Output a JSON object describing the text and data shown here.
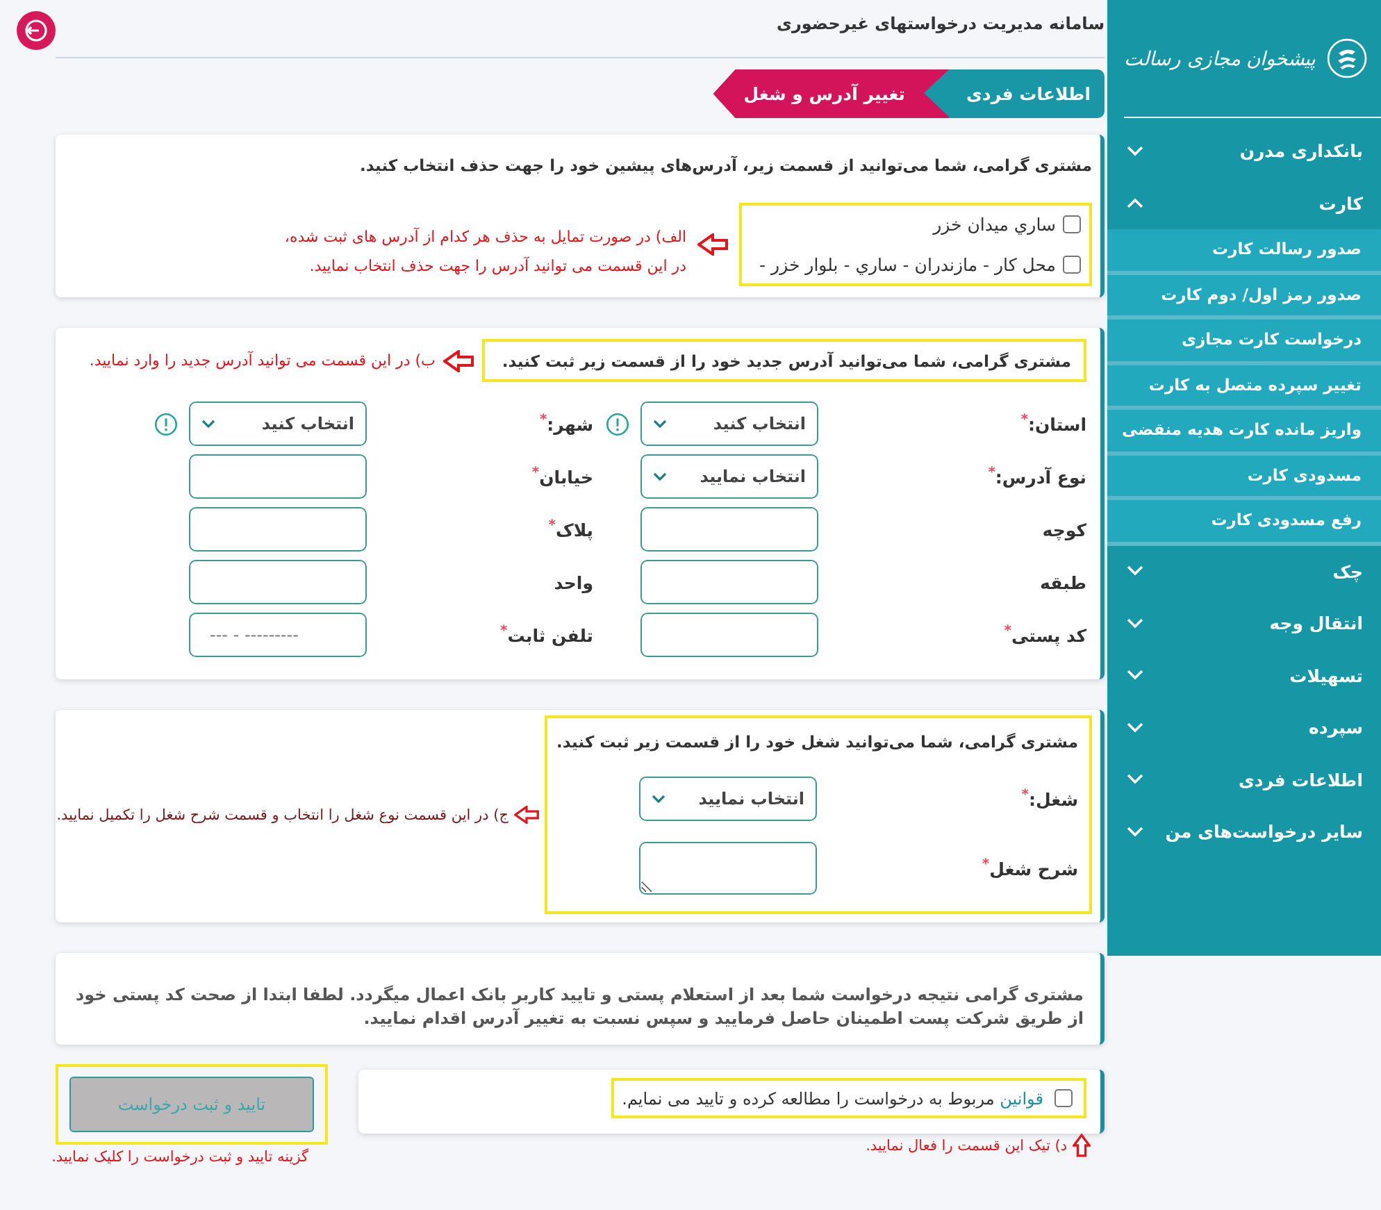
{
  "header": {
    "title": "سامانه مدیریت درخواستهای غیرحضوری"
  },
  "breadcrumb": [
    {
      "label": "اطلاعات فردی",
      "selected": false
    },
    {
      "label": "تغییر آدرس و شغل",
      "selected": true
    }
  ],
  "sidebar": {
    "brand": "پیشخوان مجازی رسالت",
    "items": [
      {
        "label": "بانکداری مدرن",
        "expanded": false
      },
      {
        "label": "کارت",
        "expanded": true,
        "children": [
          {
            "label": "صدور رسالت کارت"
          },
          {
            "label": "صدور رمز اول/ دوم کارت"
          },
          {
            "label": "درخواست کارت مجازی"
          },
          {
            "label": "تغییر سپرده متصل به کارت"
          },
          {
            "label": "واریز مانده کارت هدیه منقضی"
          },
          {
            "label": "مسدودی کارت"
          },
          {
            "label": "رفع مسدودی کارت"
          }
        ]
      },
      {
        "label": "چک",
        "expanded": false
      },
      {
        "label": "انتقال وجه",
        "expanded": false
      },
      {
        "label": "تسهیلات",
        "expanded": false
      },
      {
        "label": "سپرده",
        "expanded": false
      },
      {
        "label": "اطلاعات فردی",
        "expanded": false
      },
      {
        "label": "سایر درخواست‌های من",
        "expanded": false
      }
    ]
  },
  "addresses_section": {
    "heading": "مشتری گرامی، شما می‌توانید از قسمت زیر، آدرس‌های پیشین خود را جهت حذف انتخاب کنید.",
    "addresses": [
      {
        "label": "ساري ميدان خزر",
        "checked": false
      },
      {
        "label": "محل کار - مازندران - ساري - بلوار خزر -",
        "checked": false
      }
    ],
    "annotation": [
      "الف) در صورت تمایل به حذف هر کدام از آدرس های ثبت شده،",
      "در این قسمت می توانید آدرس را جهت حذف انتخاب نمایید."
    ]
  },
  "new_address_section": {
    "heading": "مشتری گرامی، شما می‌توانید آدرس جدید خود را از قسمت زیر ثبت کنید.",
    "annotation": "ب) در این قسمت می توانید آدرس جدید را وارد نمایید.",
    "fields": [
      {
        "label": "استان:",
        "required_mark": "*",
        "kind": "select",
        "value": "انتخاب کنید",
        "info": true
      },
      {
        "label": "شهر:",
        "required_mark": "*",
        "kind": "select",
        "value": "انتخاب کنید",
        "info": true
      },
      {
        "label": "نوع آدرس:",
        "required_mark": "*",
        "kind": "select",
        "value": "انتخاب نمایید",
        "info": false
      },
      {
        "label": "خیابان",
        "required_mark": "*",
        "kind": "text",
        "info": false
      },
      {
        "label": "کوچه",
        "kind": "text",
        "info": false
      },
      {
        "label": "پلاک",
        "required_mark": "*",
        "kind": "text",
        "info": false
      },
      {
        "label": "طبقه",
        "kind": "text",
        "info": false
      },
      {
        "label": "واحد",
        "kind": "text",
        "info": false
      },
      {
        "label": "کد پستی",
        "required_mark": "*",
        "kind": "text",
        "info": false
      },
      {
        "label": "تلفن ثابت",
        "required_mark": "*",
        "kind": "text",
        "placeholder": "--- - ---------",
        "info": false
      }
    ]
  },
  "job_section": {
    "heading": "مشتری گرامی، شما می‌توانید شغل خود را از قسمت زیر ثبت کنید.",
    "annotation": "ج) در این قسمت نوع شغل را انتخاب و قسمت شرح شغل را تکمیل نمایید.",
    "fields": [
      {
        "label": "شغل:",
        "required_mark": "*",
        "kind": "select",
        "value": "انتخاب نمایید"
      },
      {
        "label": "شرح شغل",
        "required_mark": "*",
        "kind": "textarea"
      }
    ]
  },
  "notice": "مشتری گرامی نتیجه درخواست شما بعد از استعلام پستی و تایید کاربر بانک اعمال میگردد. لطفا ابتدا از صحت کد پستی خود از طریق شرکت پست اطمینان حاصل فرمایید و سپس نسبت به تغییر آدرس اقدام نمایید.",
  "terms": {
    "link": "قوانین",
    "text": "مربوط به درخواست را مطالعه کرده و تایید می نمایم.",
    "checked": false,
    "annotation": "د) تیک این قسمت را فعال نمایید."
  },
  "submit": {
    "label": "تایید و ثبت درخواست",
    "disabled": true,
    "annotation": "گزینه تایید و ثبت درخواست را کلیک نمایید."
  }
}
